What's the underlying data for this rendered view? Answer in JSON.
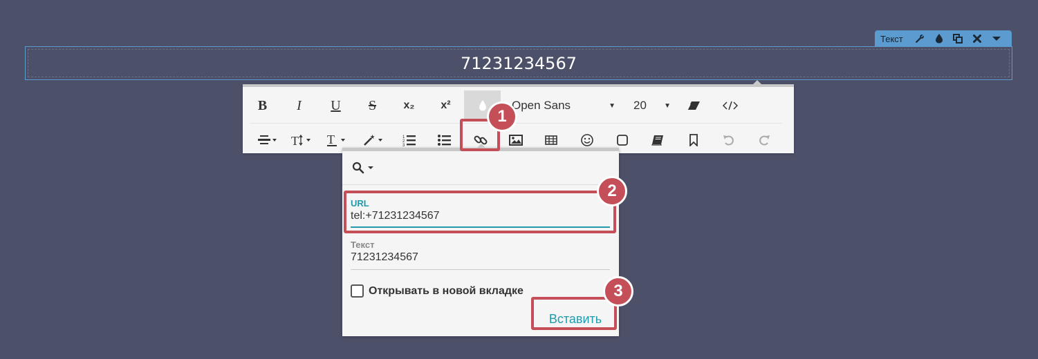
{
  "block_tag": {
    "label": "Текст",
    "icons": [
      "wrench-icon",
      "drop-icon",
      "duplicate-icon",
      "close-icon",
      "caret-down-icon"
    ]
  },
  "text_block": {
    "content": "71231234567"
  },
  "toolbar": {
    "row1": [
      {
        "name": "bold-button",
        "label": "B",
        "type": "text"
      },
      {
        "name": "italic-button",
        "label": "I",
        "type": "text"
      },
      {
        "name": "underline-button",
        "label": "U",
        "type": "text"
      },
      {
        "name": "strikethrough-button",
        "label": "S",
        "type": "text"
      },
      {
        "name": "subscript-button",
        "label": "x₂",
        "type": "text"
      },
      {
        "name": "superscript-button",
        "label": "x²",
        "type": "text"
      },
      {
        "name": "color-drop-button",
        "icon": "drop-icon",
        "type": "icon"
      }
    ],
    "font": "Open Sans",
    "font_size": "20",
    "row2": [
      {
        "name": "align-button",
        "icon": "align-center-icon"
      },
      {
        "name": "line-height-button",
        "icon": "text-height-icon"
      },
      {
        "name": "text-style-button",
        "icon": "text-style-icon"
      },
      {
        "name": "magic-button",
        "icon": "magic-wand-icon"
      },
      {
        "name": "ordered-list-button",
        "icon": "ordered-list-icon"
      },
      {
        "name": "unordered-list-button",
        "icon": "unordered-list-icon"
      },
      {
        "name": "link-button",
        "icon": "link-icon"
      },
      {
        "name": "image-button",
        "icon": "image-icon"
      },
      {
        "name": "table-button",
        "icon": "table-icon"
      },
      {
        "name": "emoji-button",
        "icon": "smile-icon"
      },
      {
        "name": "shape-button",
        "icon": "square-icon"
      },
      {
        "name": "book-button",
        "icon": "book-icon"
      },
      {
        "name": "bookmark-button",
        "icon": "bookmark-icon"
      },
      {
        "name": "undo-button",
        "icon": "undo-icon"
      },
      {
        "name": "redo-button",
        "icon": "redo-icon"
      }
    ]
  },
  "link_popup": {
    "url_label": "URL",
    "url_value": "tel:+71231234567",
    "text_label": "Текст",
    "text_value": "71231234567",
    "new_tab_label": "Открывать в новой вкладке",
    "new_tab_checked": false,
    "insert_label": "Вставить"
  },
  "annotations": {
    "badge1": "1",
    "badge2": "2",
    "badge3": "3",
    "color": "#c44f58"
  }
}
